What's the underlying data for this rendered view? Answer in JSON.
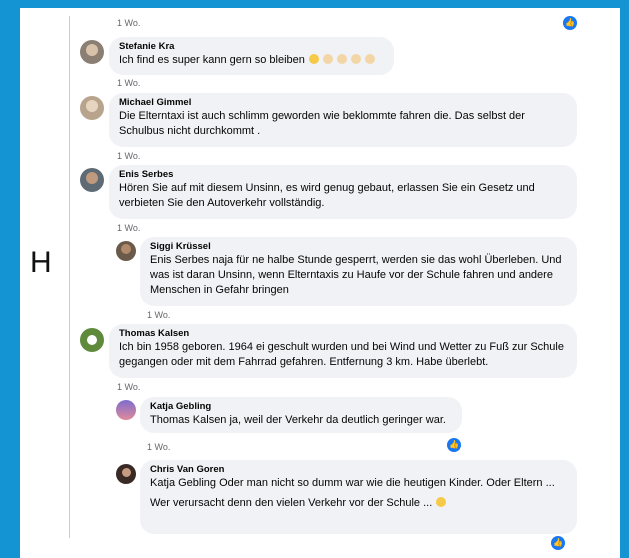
{
  "comments": [
    {
      "author": "Stefanie Kra",
      "text": "Ich find es super kann gern so bleiben",
      "time": "1 Wo."
    },
    {
      "author": "Michael Gimmel",
      "text": "Die Elterntaxi ist auch schlimm geworden wie beklommte fahren die. Das selbst der Schulbus nicht durchkommt .",
      "time": "1 Wo."
    },
    {
      "author": "Enis Serbes",
      "text": "Hören Sie auf mit diesem Unsinn, es wird genug gebaut, erlassen Sie ein Gesetz und verbieten Sie den Autoverkehr vollständig.",
      "time": "1 Wo."
    },
    {
      "author": "Siggi Krüssel",
      "text": "Enis Serbes naja für ne halbe Stunde gesperrt, werden sie das wohl Überleben. Und was ist daran Unsinn, wenn Elterntaxis zu Haufe vor der Schule fahren und andere Menschen in Gefahr bringen",
      "time": "1 Wo."
    },
    {
      "author": "Thomas Kalsen",
      "text": "Ich bin 1958 geboren. 1964 ei geschult wurden und bei Wind und Wetter zu Fuß zur Schule gegangen oder mit dem Fahrrad gefahren. Entfernung 3 km. Habe überlebt.",
      "time": "1 Wo."
    },
    {
      "author": "Katja Gebling",
      "text": "Thomas Kalsen ja, weil der Verkehr da deutlich geringer war.",
      "time": "1 Wo."
    },
    {
      "author": "Chris Van Goren",
      "text": "Katja Gebling Oder man nicht so dumm war wie die heutigen Kinder. Oder Eltern ...",
      "text2": "Wer verursacht denn den vielen Verkehr vor der Schule ..."
    }
  ],
  "top_time": "1 Wo.",
  "cursor_text": "H",
  "icons": {
    "like": "like-icon",
    "reaction": "reaction-icon"
  },
  "colors": {
    "background": "#1594d3",
    "bubble": "#f0f2f5",
    "like": "#1877f2"
  }
}
